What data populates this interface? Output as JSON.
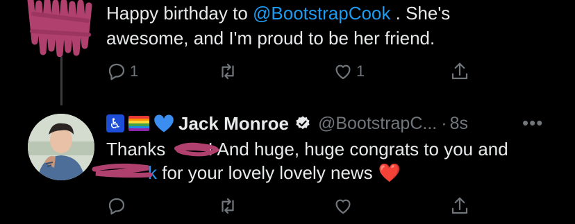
{
  "tweet1": {
    "line1_prefix": "Happy birthday to ",
    "line1_mention": "@BootstrapCook",
    "line1_suffix": " .  She's",
    "line2": "awesome, and I'm proud to be her friend.",
    "actions": {
      "reply_count": "1",
      "retweet_count": "",
      "like_count": "1"
    }
  },
  "tweet2": {
    "author_name": "Jack Monroe",
    "handle": "@BootstrapC...",
    "separator": "·",
    "time": "8s",
    "more": "•••",
    "line1_start": "Thanks ",
    "line1_end": "! And huge, huge congrats to you and",
    "line2_mention_tail": "k",
    "line2_rest": " for your lovely lovely news",
    "heart_emoji": "❤️",
    "badges": [
      "accessibility-icon",
      "rainbow-flag-icon",
      "blue-heart-icon"
    ]
  },
  "colors": {
    "background": "#000000",
    "text": "#e7e9ea",
    "muted": "#71767b",
    "link": "#1d9bf0",
    "redaction": "#b0416f"
  }
}
